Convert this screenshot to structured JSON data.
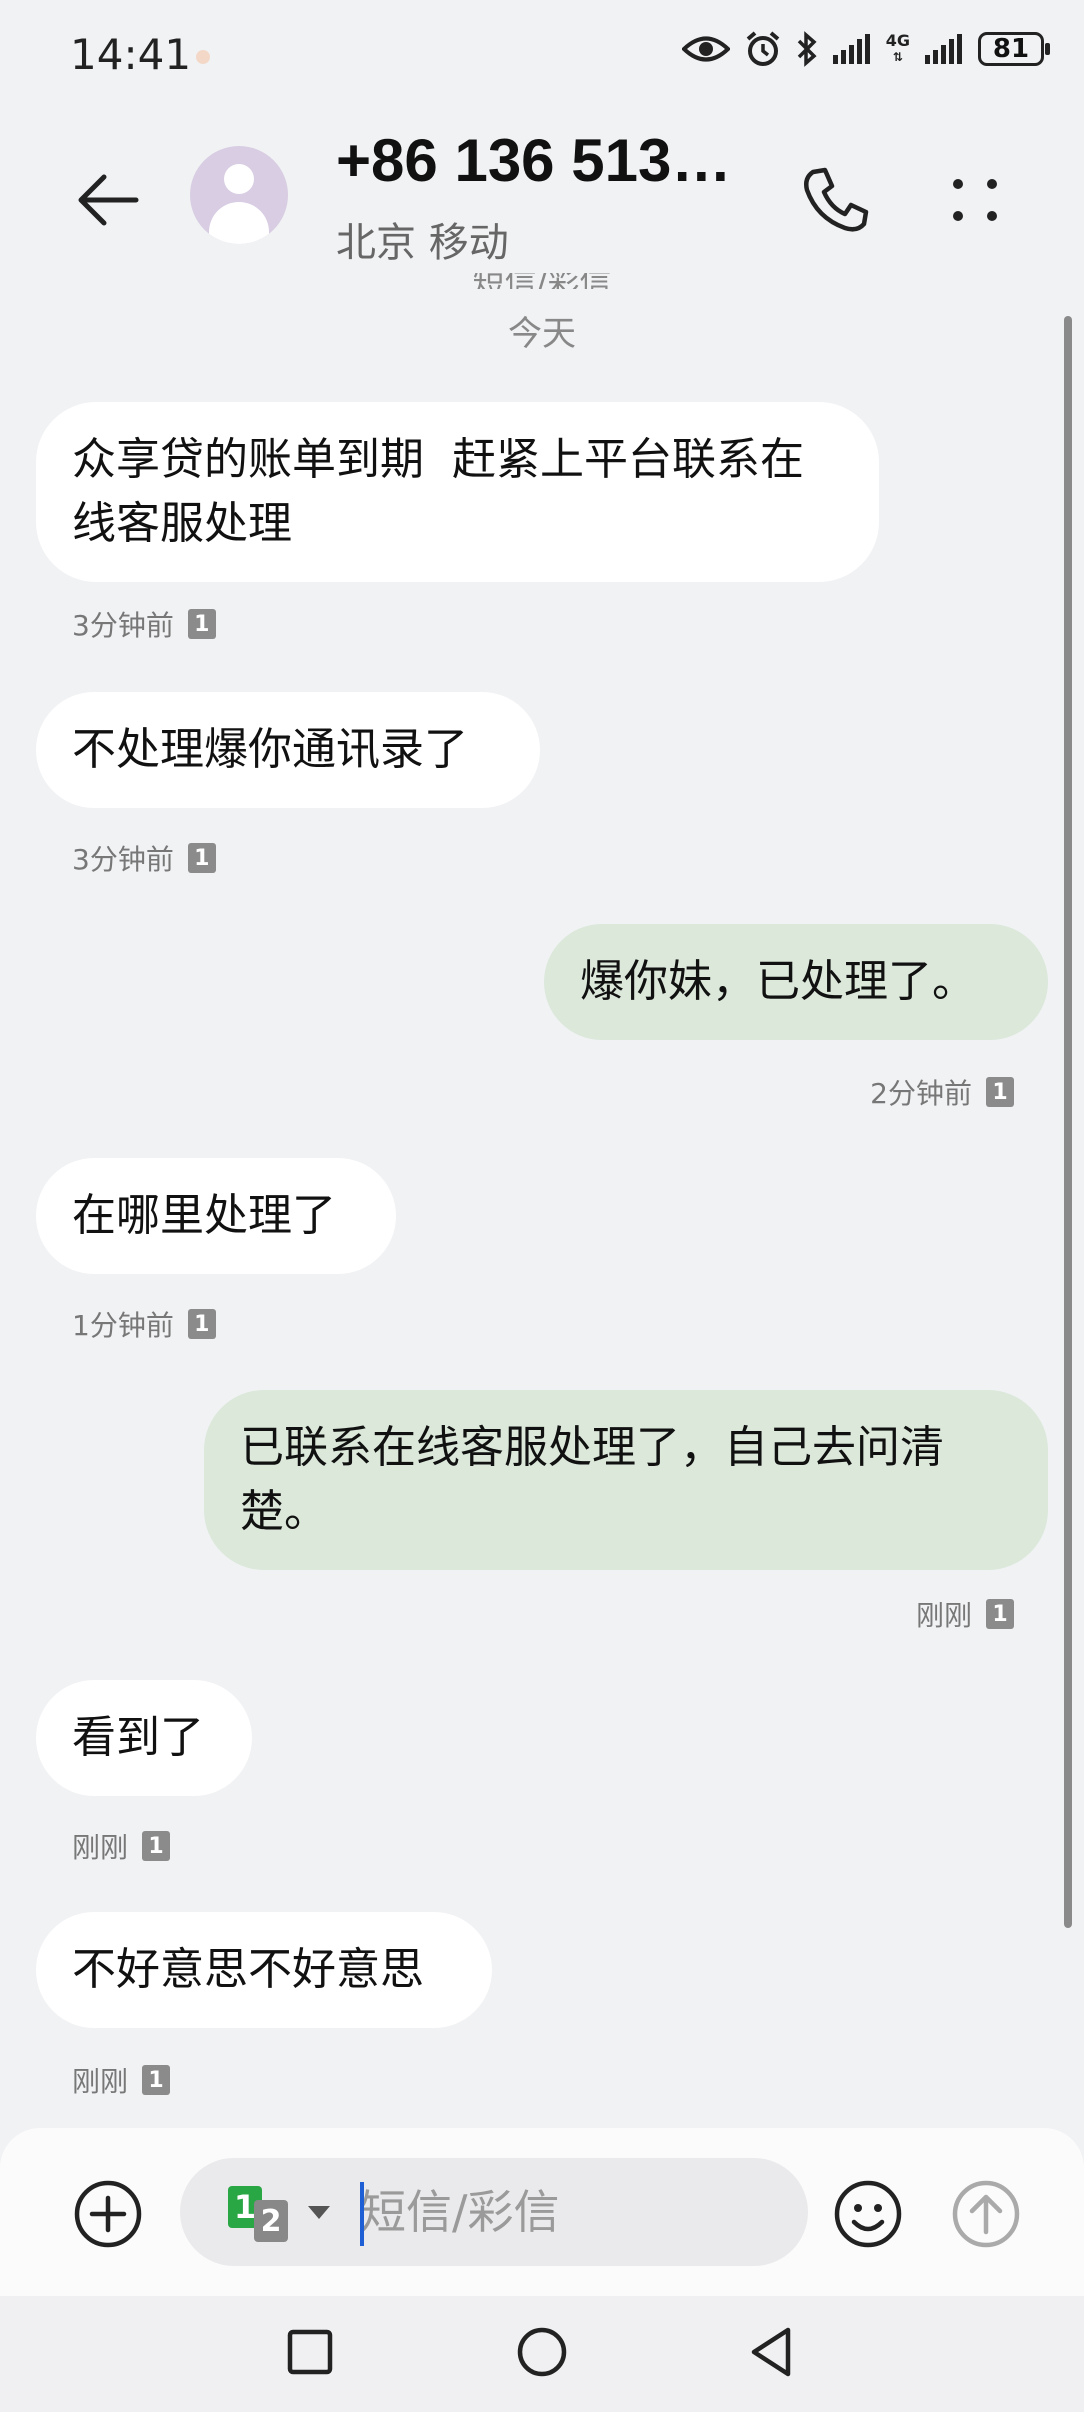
{
  "status_bar": {
    "time": "14:41",
    "network": "4G",
    "battery": "81"
  },
  "header": {
    "contact_name": "+86 136 513…",
    "contact_location": "北京 移动",
    "channel_label_cutoff": "短信/彩信",
    "date_separator": "今天"
  },
  "messages": [
    {
      "direction": "incoming",
      "text": "众享贷的账单到期  赶紧上平台联系在线客服处理",
      "time": "3分钟前",
      "sim": "1"
    },
    {
      "direction": "incoming",
      "text": "不处理爆你通讯录了",
      "time": "3分钟前",
      "sim": "1"
    },
    {
      "direction": "outgoing",
      "text": "爆你妹，已处理了。",
      "time": "2分钟前",
      "sim": "1"
    },
    {
      "direction": "incoming",
      "text": "在哪里处理了",
      "time": "1分钟前",
      "sim": "1"
    },
    {
      "direction": "outgoing",
      "text": "已联系在线客服处理了，自己去问清楚。",
      "time": "刚刚",
      "sim": "1"
    },
    {
      "direction": "incoming",
      "text": "看到了",
      "time": "刚刚",
      "sim": "1"
    },
    {
      "direction": "incoming",
      "text": "不好意思不好意思",
      "time": "刚刚",
      "sim": "1"
    }
  ],
  "composer": {
    "placeholder": "短信/彩信",
    "sim_primary": "1",
    "sim_secondary": "2"
  },
  "colors": {
    "background": "#f1f2f4",
    "incoming_bubble": "#ffffff",
    "outgoing_bubble": "#dbe8da",
    "sim1_badge": "#2aa745",
    "cursor": "#1f5fd6"
  }
}
